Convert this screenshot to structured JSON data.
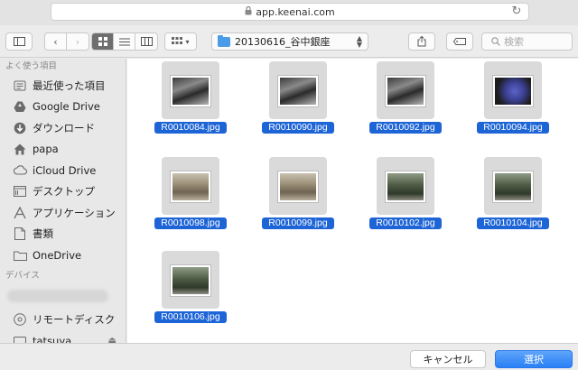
{
  "url_bar": {
    "url": "app.keenai.com"
  },
  "toolbar": {
    "path_folder": "20130616_谷中銀座",
    "search_placeholder": "検索"
  },
  "sidebar": {
    "favorites_header": "よく使う項目",
    "favorites": [
      {
        "label": "最近使った項目",
        "icon": "recent-icon"
      },
      {
        "label": "Google Drive",
        "icon": "google-drive-icon"
      },
      {
        "label": "ダウンロード",
        "icon": "download-icon"
      },
      {
        "label": "papa",
        "icon": "home-icon"
      },
      {
        "label": "iCloud Drive",
        "icon": "cloud-icon"
      },
      {
        "label": "デスクトップ",
        "icon": "desktop-icon"
      },
      {
        "label": "アプリケーション",
        "icon": "applications-icon"
      },
      {
        "label": "書類",
        "icon": "documents-icon"
      },
      {
        "label": "OneDrive",
        "icon": "folder-icon"
      }
    ],
    "devices_header": "デバイス",
    "devices": [
      {
        "label": "リモートディスク",
        "icon": "remote-disc-icon"
      },
      {
        "label": "tatsuya",
        "icon": "disk-icon"
      }
    ]
  },
  "files": [
    {
      "name": "R0010084.jpg",
      "tone": "dark",
      "orientation": "landscape"
    },
    {
      "name": "R0010090.jpg",
      "tone": "dark",
      "orientation": "landscape"
    },
    {
      "name": "R0010092.jpg",
      "tone": "dark",
      "orientation": "landscape"
    },
    {
      "name": "R0010094.jpg",
      "tone": "blue",
      "orientation": "landscape"
    },
    {
      "name": "R0010098.jpg",
      "tone": "street",
      "orientation": "landscape"
    },
    {
      "name": "R0010099.jpg",
      "tone": "street",
      "orientation": "landscape"
    },
    {
      "name": "R0010102.jpg",
      "tone": "green",
      "orientation": "landscape"
    },
    {
      "name": "R0010104.jpg",
      "tone": "green",
      "orientation": "landscape"
    },
    {
      "name": "R0010106.jpg",
      "tone": "green",
      "orientation": "landscape"
    }
  ],
  "buttons": {
    "cancel": "キャンセル",
    "ok": "選択"
  }
}
